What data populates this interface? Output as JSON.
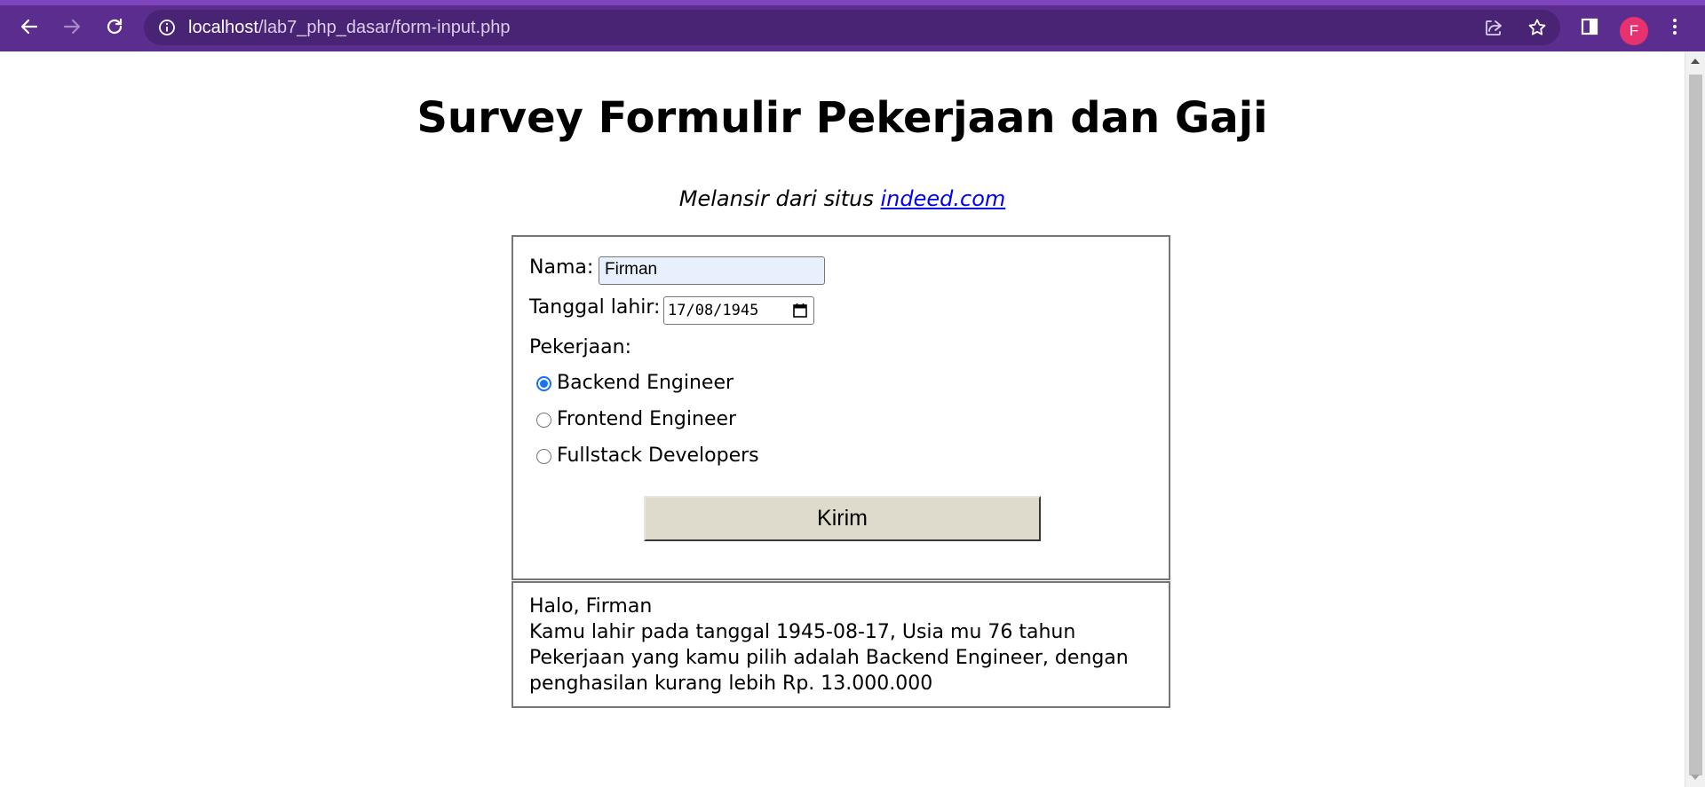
{
  "browser": {
    "url_host": "localhost",
    "url_path": "/lab7_php_dasar/form-input.php",
    "profile_initial": "F",
    "accent_color": "#5b2d8e"
  },
  "page": {
    "title": "Survey Formulir Pekerjaan dan Gaji",
    "subtitle_prefix": "Melansir dari situs ",
    "subtitle_link": "indeed.com"
  },
  "form": {
    "nama_label": "Nama:",
    "nama_value": "Firman",
    "tanggal_label": "Tanggal lahir:",
    "tanggal_value": "17/08/1945",
    "pekerjaan_label": "Pekerjaan:",
    "options": [
      {
        "label": "Backend Engineer",
        "checked": true
      },
      {
        "label": "Frontend Engineer",
        "checked": false
      },
      {
        "label": "Fullstack Developers",
        "checked": false
      }
    ],
    "submit_label": "Kirim"
  },
  "result": {
    "line1": "Halo, Firman",
    "line2": "Kamu lahir pada tanggal 1945-08-17, Usia mu 76 tahun",
    "line3": "Pekerjaan yang kamu pilih adalah Backend Engineer, dengan",
    "line4": "penghasilan kurang lebih Rp. 13.000.000"
  }
}
